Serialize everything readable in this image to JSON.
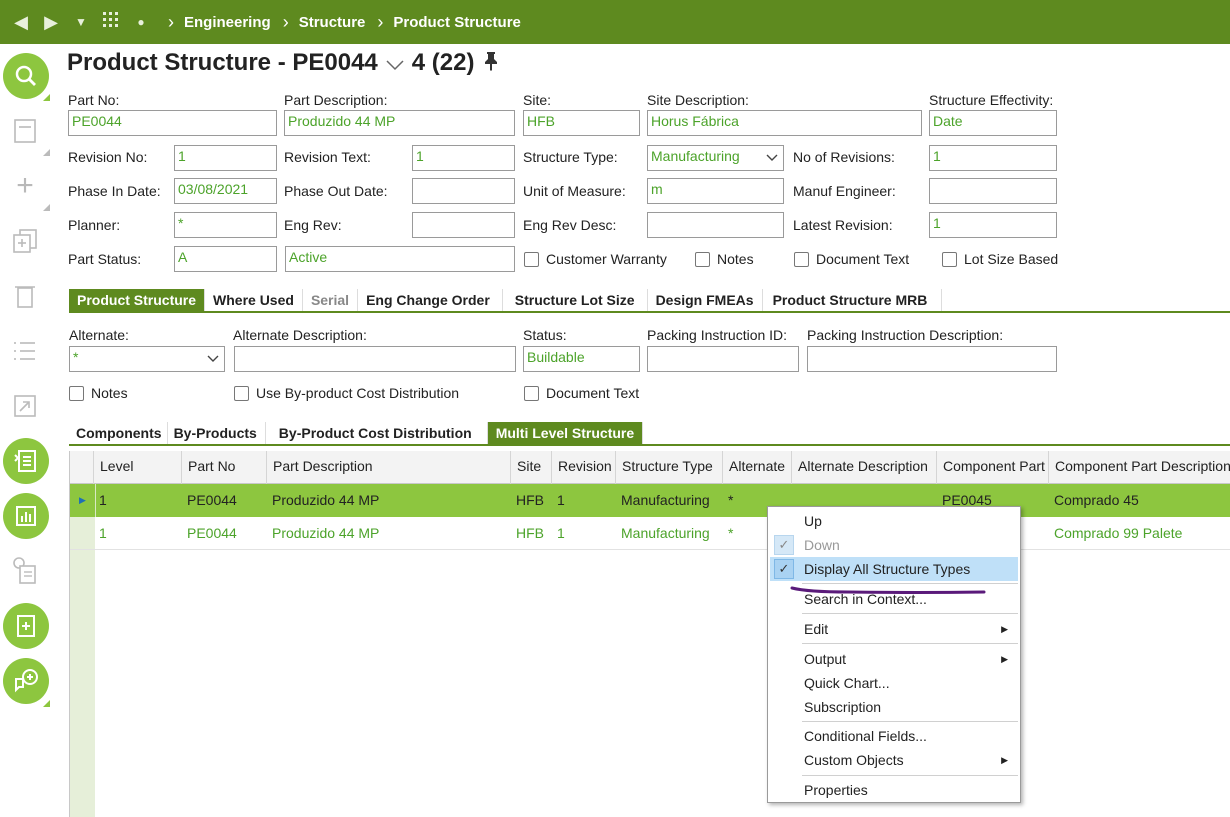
{
  "breadcrumbs": [
    "Engineering",
    "Structure",
    "Product Structure"
  ],
  "page": {
    "title": "Product Structure - PE0044",
    "count": "4 (22)"
  },
  "header_form": {
    "part_no": {
      "label": "Part No:",
      "value": "PE0044"
    },
    "part_description": {
      "label": "Part Description:",
      "value": "Produzido 44 MP"
    },
    "site": {
      "label": "Site:",
      "value": "HFB"
    },
    "site_description": {
      "label": "Site Description:",
      "value": "Horus Fábrica"
    },
    "structure_effectivity": {
      "label": "Structure Effectivity:",
      "value": "Date"
    },
    "revision_no": {
      "label": "Revision No:",
      "value": "1"
    },
    "revision_text": {
      "label": "Revision Text:",
      "value": "1"
    },
    "structure_type": {
      "label": "Structure Type:",
      "value": "Manufacturing"
    },
    "no_of_revisions": {
      "label": "No of Revisions:",
      "value": "1"
    },
    "phase_in_date": {
      "label": "Phase In Date:",
      "value": "03/08/2021"
    },
    "phase_out_date": {
      "label": "Phase Out Date:",
      "value": ""
    },
    "unit_of_measure": {
      "label": "Unit of Measure:",
      "value": "m"
    },
    "manuf_engineer": {
      "label": "Manuf Engineer:",
      "value": ""
    },
    "planner": {
      "label": "Planner:",
      "value": "*"
    },
    "eng_rev": {
      "label": "Eng Rev:",
      "value": ""
    },
    "eng_rev_desc": {
      "label": "Eng Rev Desc:",
      "value": ""
    },
    "latest_revision": {
      "label": "Latest Revision:",
      "value": "1"
    },
    "part_status": {
      "label": "Part Status:",
      "value": "A",
      "description": "Active"
    },
    "checkboxes": [
      "Customer Warranty",
      "Notes",
      "Document Text",
      "Lot Size Based"
    ]
  },
  "main_tabs": [
    "Product Structure",
    "Where Used",
    "Serial",
    "Eng Change Order",
    "Structure Lot Size",
    "Design FMEAs",
    "Product Structure MRB"
  ],
  "alt_form": {
    "alternate": {
      "label": "Alternate:",
      "value": "*"
    },
    "alternate_description": {
      "label": "Alternate Description:",
      "value": ""
    },
    "status": {
      "label": "Status:",
      "value": "Buildable"
    },
    "packing_instruction_id": {
      "label": "Packing Instruction ID:",
      "value": ""
    },
    "packing_instruction_description": {
      "label": "Packing Instruction Description:",
      "value": ""
    },
    "checkboxes": [
      "Notes",
      "Use By-product Cost Distribution",
      "Document Text"
    ]
  },
  "sub_tabs": [
    "Components",
    "By-Products",
    "By-Product Cost Distribution",
    "Multi Level Structure"
  ],
  "grid": {
    "columns": [
      "Level",
      "Part No",
      "Part Description",
      "Site",
      "Revision",
      "Structure Type",
      "Alternate",
      "Alternate Description",
      "Component Part",
      "Component Part Description"
    ],
    "rows": [
      [
        "1",
        "PE0044",
        "Produzido 44 MP",
        "HFB",
        "1",
        "Manufacturing",
        "*",
        "",
        "PE0045",
        "Comprado 45"
      ],
      [
        "1",
        "PE0044",
        "Produzido 44 MP",
        "HFB",
        "1",
        "Manufacturing",
        "*",
        "",
        "",
        "Comprado 99 Palete"
      ]
    ]
  },
  "context_menu": {
    "items": [
      "Up",
      "Down",
      "Display All Structure Types",
      "Search in Context...",
      "Edit",
      "Output",
      "Quick Chart...",
      "Subscription",
      "Conditional Fields...",
      "Custom Objects",
      "Properties"
    ]
  },
  "colors": {
    "brand": "#5e8a1f",
    "accent": "#8dc63f",
    "value_text": "#4ca32a",
    "highlight": "#bfe0f8"
  }
}
